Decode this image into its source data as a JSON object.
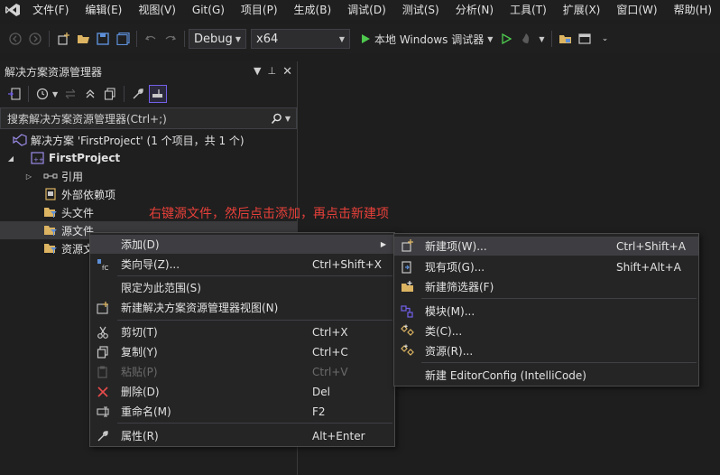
{
  "menubar": {
    "items": [
      "文件(F)",
      "编辑(E)",
      "视图(V)",
      "Git(G)",
      "项目(P)",
      "生成(B)",
      "调试(D)",
      "测试(S)",
      "分析(N)",
      "工具(T)",
      "扩展(X)",
      "窗口(W)",
      "帮助(H)"
    ]
  },
  "toolbar": {
    "config": "Debug",
    "platform": "x64",
    "run_label": "本地 Windows 调试器"
  },
  "solution_explorer": {
    "title": "解决方案资源管理器",
    "search_placeholder": "搜索解决方案资源管理器(Ctrl+;)",
    "tree": {
      "solution": "解决方案 'FirstProject' (1 个项目，共 1 个)",
      "project": "FirstProject",
      "references": "引用",
      "external_deps": "外部依赖项",
      "header_files": "头文件",
      "source_files": "源文件",
      "resource_files": "资源文件"
    }
  },
  "annotation": "右键源文件，然后点击添加，再点击新建项",
  "context_menu": {
    "add": "添加(D)",
    "class_wizard": "类向导(Z)...",
    "class_wizard_sc": "Ctrl+Shift+X",
    "scope": "限定为此范围(S)",
    "new_view": "新建解决方案资源管理器视图(N)",
    "cut": "剪切(T)",
    "cut_sc": "Ctrl+X",
    "copy": "复制(Y)",
    "copy_sc": "Ctrl+C",
    "paste": "粘贴(P)",
    "paste_sc": "Ctrl+V",
    "delete": "删除(D)",
    "delete_sc": "Del",
    "rename": "重命名(M)",
    "rename_sc": "F2",
    "properties": "属性(R)",
    "properties_sc": "Alt+Enter"
  },
  "submenu": {
    "new_item": "新建项(W)...",
    "new_item_sc": "Ctrl+Shift+A",
    "existing_item": "现有项(G)...",
    "existing_item_sc": "Shift+Alt+A",
    "new_filter": "新建筛选器(F)",
    "module": "模块(M)...",
    "class": "类(C)...",
    "resource": "资源(R)...",
    "editorconfig": "新建 EditorConfig (IntelliCode)"
  },
  "colors": {
    "accent": "#7160e8",
    "annotation": "#e8403a",
    "run_green": "#4ec94e",
    "folder": "#dcb462"
  }
}
